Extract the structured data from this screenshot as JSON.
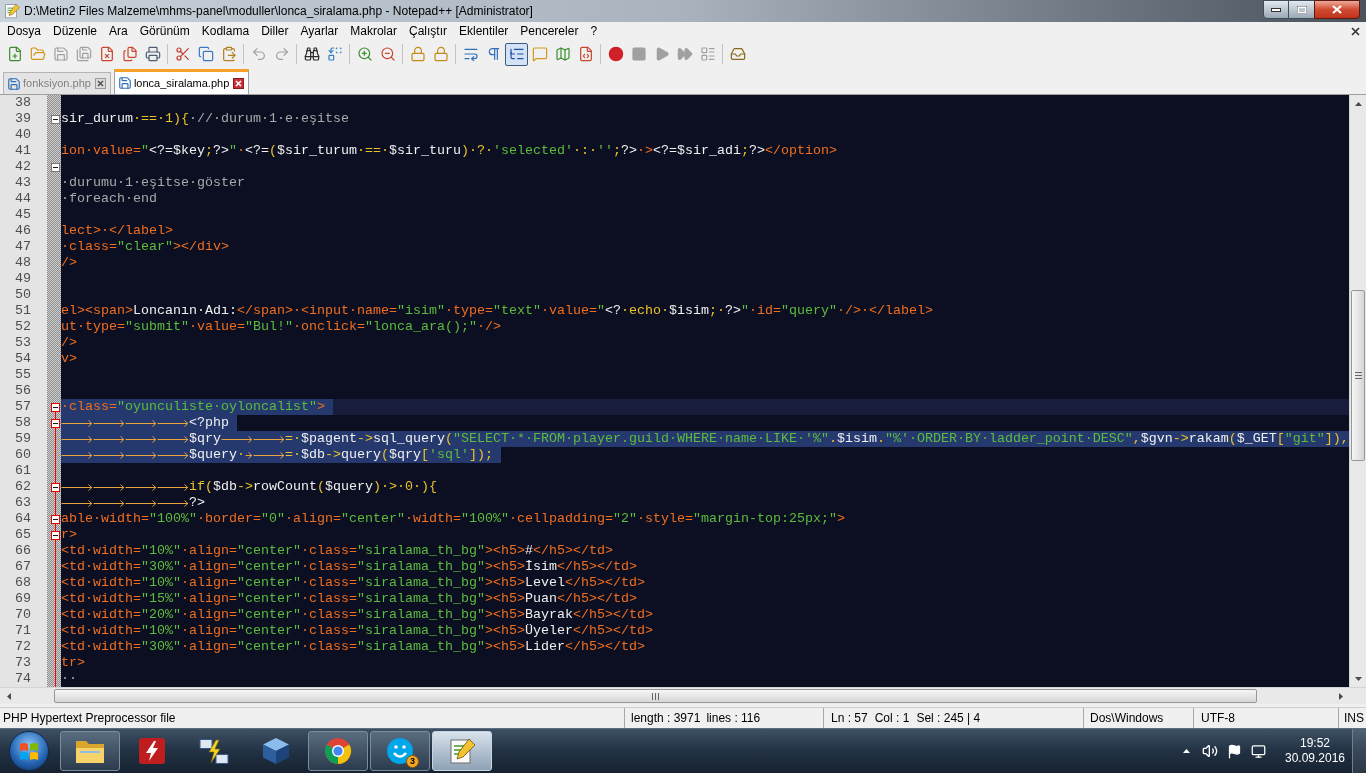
{
  "window": {
    "title": "D:\\Metin2 Files Malzeme\\mhms-panel\\moduller\\lonca_siralama.php - Notepad++ [Administrator]"
  },
  "menu": [
    "Dosya",
    "Düzenle",
    "Ara",
    "Görünüm",
    "Kodlama",
    "Diller",
    "Ayarlar",
    "Makrolar",
    "Çalıştır",
    "Eklentiler",
    "Pencereler",
    "?"
  ],
  "toolbar": [
    [
      {
        "kind": "new",
        "pressed": false,
        "disabled": false
      },
      {
        "kind": "open",
        "pressed": false,
        "disabled": false
      },
      {
        "kind": "save",
        "pressed": false,
        "disabled": true
      },
      {
        "kind": "saveall",
        "pressed": false,
        "disabled": true
      },
      {
        "kind": "close",
        "pressed": false,
        "disabled": false
      },
      {
        "kind": "closeall",
        "pressed": false,
        "disabled": false
      },
      {
        "kind": "print",
        "pressed": false,
        "disabled": false
      }
    ],
    [
      {
        "kind": "cut",
        "pressed": false,
        "disabled": false
      },
      {
        "kind": "copy",
        "pressed": false,
        "disabled": false
      },
      {
        "kind": "paste",
        "pressed": false,
        "disabled": false
      }
    ],
    [
      {
        "kind": "undo",
        "pressed": false,
        "disabled": true
      },
      {
        "kind": "redo",
        "pressed": false,
        "disabled": true
      }
    ],
    [
      {
        "kind": "find",
        "pressed": false,
        "disabled": false
      },
      {
        "kind": "replace",
        "pressed": false,
        "disabled": false
      }
    ],
    [
      {
        "kind": "zoomin",
        "pressed": false,
        "disabled": false
      },
      {
        "kind": "zoomout",
        "pressed": false,
        "disabled": false
      }
    ],
    [
      {
        "kind": "syncv",
        "pressed": false,
        "disabled": false
      },
      {
        "kind": "synch",
        "pressed": false,
        "disabled": false
      }
    ],
    [
      {
        "kind": "wrap",
        "pressed": false,
        "disabled": false
      },
      {
        "kind": "allchars",
        "pressed": false,
        "disabled": false
      },
      {
        "kind": "indent",
        "pressed": true,
        "disabled": false
      },
      {
        "kind": "udl",
        "pressed": false,
        "disabled": false
      },
      {
        "kind": "docmap",
        "pressed": false,
        "disabled": false
      },
      {
        "kind": "funclist",
        "pressed": false,
        "disabled": false
      }
    ],
    [
      {
        "kind": "record",
        "pressed": false,
        "disabled": false
      },
      {
        "kind": "stop",
        "pressed": false,
        "disabled": true
      },
      {
        "kind": "play",
        "pressed": false,
        "disabled": true
      },
      {
        "kind": "playmulti",
        "pressed": false,
        "disabled": true
      },
      {
        "kind": "savemacro",
        "pressed": false,
        "disabled": true
      }
    ],
    [
      {
        "kind": "plugin",
        "pressed": false,
        "disabled": false
      }
    ]
  ],
  "tabs": [
    {
      "label": "fonksiyon.php",
      "selected": false
    },
    {
      "label": "lonca_siralama.php",
      "selected": true
    }
  ],
  "editor": {
    "lines": [
      {
        "number": "38",
        "kind": "plain",
        "current": false,
        "selected": false
      },
      {
        "number": "39",
        "kind": "head",
        "fold_highlight": false,
        "current": false,
        "selected": false,
        "tokens": [
          {
            "kind": "php",
            "text": "sir_durum"
          },
          {
            "kind": "op",
            "text": "·==·1){"
          },
          {
            "kind": "cmt",
            "text": "·//·durum·1·e·eşitse"
          }
        ]
      },
      {
        "number": "40",
        "kind": "body",
        "current": false,
        "selected": false
      },
      {
        "number": "41",
        "kind": "body",
        "current": false,
        "selected": false,
        "tokens": [
          {
            "kind": "tag",
            "text": "ion·value="
          },
          {
            "kind": "str",
            "text": "\""
          },
          {
            "kind": "php",
            "text": "<?=$key"
          },
          {
            "kind": "op",
            "text": ";"
          },
          {
            "kind": "php",
            "text": "?>"
          },
          {
            "kind": "str",
            "text": "\""
          },
          {
            "kind": "tag",
            "text": "·"
          },
          {
            "kind": "php",
            "text": "<?="
          },
          {
            "kind": "op",
            "text": "("
          },
          {
            "kind": "php",
            "text": "$sir_turum"
          },
          {
            "kind": "op",
            "text": "·==·"
          },
          {
            "kind": "php",
            "text": "$sir_turu"
          },
          {
            "kind": "op",
            "text": ")·?·"
          },
          {
            "kind": "str",
            "text": "'selected'"
          },
          {
            "kind": "op",
            "text": "·:·"
          },
          {
            "kind": "str",
            "text": "''"
          },
          {
            "kind": "op",
            "text": ";"
          },
          {
            "kind": "php",
            "text": "?>"
          },
          {
            "kind": "tag",
            "text": "·>"
          },
          {
            "kind": "php",
            "text": "<?=$sir_adi"
          },
          {
            "kind": "op",
            "text": ";"
          },
          {
            "kind": "php",
            "text": "?>"
          },
          {
            "kind": "tag",
            "text": "</option>"
          }
        ]
      },
      {
        "number": "42",
        "kind": "head",
        "fold_highlight": false,
        "current": false,
        "selected": false
      },
      {
        "number": "43",
        "kind": "body",
        "current": false,
        "selected": false,
        "tokens": [
          {
            "kind": "cmt",
            "text": "·durumu·1·eşitse·göster"
          }
        ]
      },
      {
        "number": "44",
        "kind": "body",
        "current": false,
        "selected": false,
        "tokens": [
          {
            "kind": "cmt",
            "text": "·foreach·end"
          }
        ]
      },
      {
        "number": "45",
        "kind": "body",
        "current": false,
        "selected": false
      },
      {
        "number": "46",
        "kind": "body",
        "current": false,
        "selected": false,
        "tokens": [
          {
            "kind": "tag",
            "text": "lect>·</label>"
          }
        ]
      },
      {
        "number": "47",
        "kind": "body",
        "current": false,
        "selected": false,
        "tokens": [
          {
            "kind": "tag",
            "text": "·class="
          },
          {
            "kind": "str",
            "text": "\"clear\""
          },
          {
            "kind": "tag",
            "text": "></div>"
          }
        ]
      },
      {
        "number": "48",
        "kind": "body",
        "current": false,
        "selected": false,
        "tokens": [
          {
            "kind": "tag",
            "text": "/>"
          }
        ]
      },
      {
        "number": "49",
        "kind": "body",
        "current": false,
        "selected": false
      },
      {
        "number": "50",
        "kind": "body",
        "current": false,
        "selected": false
      },
      {
        "number": "51",
        "kind": "body",
        "current": false,
        "selected": false,
        "tokens": [
          {
            "kind": "tag",
            "text": "el><span>"
          },
          {
            "kind": "php",
            "text": "Loncanın·Adı:"
          },
          {
            "kind": "tag",
            "text": "</span>·<input·name="
          },
          {
            "kind": "str",
            "text": "\"isim\""
          },
          {
            "kind": "tag",
            "text": "·type="
          },
          {
            "kind": "str",
            "text": "\"text\""
          },
          {
            "kind": "tag",
            "text": "·value="
          },
          {
            "kind": "str",
            "text": "\""
          },
          {
            "kind": "php",
            "text": "<?"
          },
          {
            "kind": "op",
            "text": "·echo·"
          },
          {
            "kind": "php",
            "text": "$isim"
          },
          {
            "kind": "op",
            "text": ";·"
          },
          {
            "kind": "php",
            "text": "?>"
          },
          {
            "kind": "str",
            "text": "\""
          },
          {
            "kind": "tag",
            "text": "·id="
          },
          {
            "kind": "str",
            "text": "\"query\""
          },
          {
            "kind": "tag",
            "text": "·/>·</label>"
          }
        ]
      },
      {
        "number": "52",
        "kind": "body",
        "current": false,
        "selected": false,
        "tokens": [
          {
            "kind": "tag",
            "text": "ut·type="
          },
          {
            "kind": "str",
            "text": "\"submit\""
          },
          {
            "kind": "tag",
            "text": "·value="
          },
          {
            "kind": "str",
            "text": "\"Bul!\""
          },
          {
            "kind": "tag",
            "text": "·onclick="
          },
          {
            "kind": "str",
            "text": "\"lonca_ara();\""
          },
          {
            "kind": "tag",
            "text": "·/>"
          }
        ]
      },
      {
        "number": "53",
        "kind": "body",
        "current": false,
        "selected": false,
        "tokens": [
          {
            "kind": "tag",
            "text": "/>"
          }
        ]
      },
      {
        "number": "54",
        "kind": "body",
        "current": false,
        "selected": false,
        "tokens": [
          {
            "kind": "tag",
            "text": "v>"
          }
        ]
      },
      {
        "number": "55",
        "kind": "body",
        "current": false,
        "selected": false
      },
      {
        "number": "56",
        "kind": "body",
        "current": false,
        "selected": false
      },
      {
        "number": "57",
        "kind": "head",
        "fold_highlight": true,
        "current": true,
        "selected": true,
        "tokens": [
          {
            "kind": "tag",
            "text": "·class="
          },
          {
            "kind": "str",
            "text": "\"oyunculiste·oyloncalist\""
          },
          {
            "kind": "tag",
            "text": ">"
          }
        ]
      },
      {
        "number": "58",
        "kind": "head",
        "fold_highlight": true,
        "current": false,
        "selected": true,
        "tokens": [
          {
            "kind": "tab"
          },
          {
            "kind": "tab"
          },
          {
            "kind": "tab"
          },
          {
            "kind": "tab"
          },
          {
            "kind": "php",
            "text": "<?php"
          }
        ]
      },
      {
        "number": "59",
        "kind": "body",
        "current": false,
        "selected": true,
        "tokens": [
          {
            "kind": "tab"
          },
          {
            "kind": "tab"
          },
          {
            "kind": "tab"
          },
          {
            "kind": "tab"
          },
          {
            "kind": "php",
            "text": "$qry"
          },
          {
            "kind": "tab"
          },
          {
            "kind": "tab"
          },
          {
            "kind": "op",
            "text": "=·"
          },
          {
            "kind": "php",
            "text": "$pagent"
          },
          {
            "kind": "op",
            "text": "->"
          },
          {
            "kind": "php",
            "text": "sql_query"
          },
          {
            "kind": "op",
            "text": "("
          },
          {
            "kind": "str",
            "text": "\"SELECT·*·FROM·player.guild·WHERE·name·LIKE·'%\""
          },
          {
            "kind": "op",
            "text": "."
          },
          {
            "kind": "php",
            "text": "$isim"
          },
          {
            "kind": "op",
            "text": "."
          },
          {
            "kind": "str",
            "text": "\"%'·ORDER·BY·ladder_point·DESC\""
          },
          {
            "kind": "op",
            "text": ","
          },
          {
            "kind": "php",
            "text": "$gvn"
          },
          {
            "kind": "op",
            "text": "->"
          },
          {
            "kind": "php",
            "text": "rakam"
          },
          {
            "kind": "op",
            "text": "("
          },
          {
            "kind": "php",
            "text": "$_GET"
          },
          {
            "kind": "op",
            "text": "["
          },
          {
            "kind": "str",
            "text": "\"git\""
          },
          {
            "kind": "op",
            "text": "]),"
          }
        ]
      },
      {
        "number": "60",
        "kind": "body",
        "current": false,
        "selected": true,
        "tokens": [
          {
            "kind": "tab"
          },
          {
            "kind": "tab"
          },
          {
            "kind": "tab"
          },
          {
            "kind": "tab"
          },
          {
            "kind": "php",
            "text": "$query"
          },
          {
            "kind": "op",
            "text": "·"
          },
          {
            "kind": "tab"
          },
          {
            "kind": "tab"
          },
          {
            "kind": "op",
            "text": "=·"
          },
          {
            "kind": "php",
            "text": "$db"
          },
          {
            "kind": "op",
            "text": "->"
          },
          {
            "kind": "php",
            "text": "query"
          },
          {
            "kind": "op",
            "text": "("
          },
          {
            "kind": "php",
            "text": "$qry"
          },
          {
            "kind": "op",
            "text": "["
          },
          {
            "kind": "str",
            "text": "'sql'"
          },
          {
            "kind": "op",
            "text": "]);"
          }
        ]
      },
      {
        "number": "61",
        "kind": "body",
        "current": false,
        "selected": false
      },
      {
        "number": "62",
        "kind": "head",
        "fold_highlight": true,
        "current": false,
        "selected": false,
        "tokens": [
          {
            "kind": "tab"
          },
          {
            "kind": "tab"
          },
          {
            "kind": "tab"
          },
          {
            "kind": "tab"
          },
          {
            "kind": "op",
            "text": "if("
          },
          {
            "kind": "php",
            "text": "$db"
          },
          {
            "kind": "op",
            "text": "->"
          },
          {
            "kind": "php",
            "text": "rowCount"
          },
          {
            "kind": "op",
            "text": "("
          },
          {
            "kind": "php",
            "text": "$query"
          },
          {
            "kind": "op",
            "text": ")·>·0·){"
          }
        ]
      },
      {
        "number": "63",
        "kind": "body",
        "current": false,
        "selected": false,
        "tokens": [
          {
            "kind": "tab"
          },
          {
            "kind": "tab"
          },
          {
            "kind": "tab"
          },
          {
            "kind": "tab"
          },
          {
            "kind": "php",
            "text": "?>"
          }
        ]
      },
      {
        "number": "64",
        "kind": "head",
        "fold_highlight": true,
        "current": false,
        "selected": false,
        "tokens": [
          {
            "kind": "tag",
            "text": "able·width="
          },
          {
            "kind": "str",
            "text": "\"100%\""
          },
          {
            "kind": "tag",
            "text": "·border="
          },
          {
            "kind": "str",
            "text": "\"0\""
          },
          {
            "kind": "tag",
            "text": "·align="
          },
          {
            "kind": "str",
            "text": "\"center\""
          },
          {
            "kind": "tag",
            "text": "·width="
          },
          {
            "kind": "str",
            "text": "\"100%\""
          },
          {
            "kind": "tag",
            "text": "·cellpadding="
          },
          {
            "kind": "str",
            "text": "\"2\""
          },
          {
            "kind": "tag",
            "text": "·style="
          },
          {
            "kind": "str",
            "text": "\"margin-top:25px;\""
          },
          {
            "kind": "tag",
            "text": ">"
          }
        ]
      },
      {
        "number": "65",
        "kind": "head",
        "fold_highlight": true,
        "current": false,
        "selected": false,
        "tokens": [
          {
            "kind": "tag",
            "text": "r>"
          }
        ]
      },
      {
        "number": "66",
        "kind": "body",
        "current": false,
        "selected": false,
        "tokens": [
          {
            "kind": "tag",
            "text": "<td·width="
          },
          {
            "kind": "str",
            "text": "\"10%\""
          },
          {
            "kind": "tag",
            "text": "·align="
          },
          {
            "kind": "str",
            "text": "\"center\""
          },
          {
            "kind": "tag",
            "text": "·class="
          },
          {
            "kind": "str",
            "text": "\"siralama_th_bg\""
          },
          {
            "kind": "tag",
            "text": "><h5>"
          },
          {
            "kind": "php",
            "text": "#"
          },
          {
            "kind": "tag",
            "text": "</h5></td>"
          }
        ]
      },
      {
        "number": "67",
        "kind": "body",
        "current": false,
        "selected": false,
        "tokens": [
          {
            "kind": "tag",
            "text": "<td·width="
          },
          {
            "kind": "str",
            "text": "\"30%\""
          },
          {
            "kind": "tag",
            "text": "·align="
          },
          {
            "kind": "str",
            "text": "\"center\""
          },
          {
            "kind": "tag",
            "text": "·class="
          },
          {
            "kind": "str",
            "text": "\"siralama_th_bg\""
          },
          {
            "kind": "tag",
            "text": "><h5>"
          },
          {
            "kind": "php",
            "text": "İsim"
          },
          {
            "kind": "tag",
            "text": "</h5></td>"
          }
        ]
      },
      {
        "number": "68",
        "kind": "body",
        "current": false,
        "selected": false,
        "tokens": [
          {
            "kind": "tag",
            "text": "<td·width="
          },
          {
            "kind": "str",
            "text": "\"10%\""
          },
          {
            "kind": "tag",
            "text": "·align="
          },
          {
            "kind": "str",
            "text": "\"center\""
          },
          {
            "kind": "tag",
            "text": "·class="
          },
          {
            "kind": "str",
            "text": "\"siralama_th_bg\""
          },
          {
            "kind": "tag",
            "text": "><h5>"
          },
          {
            "kind": "php",
            "text": "Level"
          },
          {
            "kind": "tag",
            "text": "</h5></td>"
          }
        ]
      },
      {
        "number": "69",
        "kind": "body",
        "current": false,
        "selected": false,
        "tokens": [
          {
            "kind": "tag",
            "text": "<td·width="
          },
          {
            "kind": "str",
            "text": "\"15%\""
          },
          {
            "kind": "tag",
            "text": "·align="
          },
          {
            "kind": "str",
            "text": "\"center\""
          },
          {
            "kind": "tag",
            "text": "·class="
          },
          {
            "kind": "str",
            "text": "\"siralama_th_bg\""
          },
          {
            "kind": "tag",
            "text": "><h5>"
          },
          {
            "kind": "php",
            "text": "Puan"
          },
          {
            "kind": "tag",
            "text": "</h5></td>"
          }
        ]
      },
      {
        "number": "70",
        "kind": "body",
        "current": false,
        "selected": false,
        "tokens": [
          {
            "kind": "tag",
            "text": "<td·width="
          },
          {
            "kind": "str",
            "text": "\"20%\""
          },
          {
            "kind": "tag",
            "text": "·align="
          },
          {
            "kind": "str",
            "text": "\"center\""
          },
          {
            "kind": "tag",
            "text": "·class="
          },
          {
            "kind": "str",
            "text": "\"siralama_th_bg\""
          },
          {
            "kind": "tag",
            "text": "><h5>"
          },
          {
            "kind": "php",
            "text": "Bayrak"
          },
          {
            "kind": "tag",
            "text": "</h5></td>"
          }
        ]
      },
      {
        "number": "71",
        "kind": "body",
        "current": false,
        "selected": false,
        "tokens": [
          {
            "kind": "tag",
            "text": "<td·width="
          },
          {
            "kind": "str",
            "text": "\"10%\""
          },
          {
            "kind": "tag",
            "text": "·align="
          },
          {
            "kind": "str",
            "text": "\"center\""
          },
          {
            "kind": "tag",
            "text": "·class="
          },
          {
            "kind": "str",
            "text": "\"siralama_th_bg\""
          },
          {
            "kind": "tag",
            "text": "><h5>"
          },
          {
            "kind": "php",
            "text": "Üyeler"
          },
          {
            "kind": "tag",
            "text": "</h5></td>"
          }
        ]
      },
      {
        "number": "72",
        "kind": "body",
        "current": false,
        "selected": false,
        "tokens": [
          {
            "kind": "tag",
            "text": "<td·width="
          },
          {
            "kind": "str",
            "text": "\"30%\""
          },
          {
            "kind": "tag",
            "text": "·align="
          },
          {
            "kind": "str",
            "text": "\"center\""
          },
          {
            "kind": "tag",
            "text": "·class="
          },
          {
            "kind": "str",
            "text": "\"siralama_th_bg\""
          },
          {
            "kind": "tag",
            "text": "><h5>"
          },
          {
            "kind": "php",
            "text": "Lider"
          },
          {
            "kind": "tag",
            "text": "</h5></td>"
          }
        ]
      },
      {
        "number": "73",
        "kind": "body",
        "current": false,
        "selected": false,
        "tokens": [
          {
            "kind": "tag",
            "text": "tr>"
          }
        ]
      },
      {
        "number": "74",
        "kind": "body",
        "current": false,
        "selected": false,
        "tokens": [
          {
            "kind": "cmt",
            "text": "··"
          }
        ]
      }
    ]
  },
  "status_bar": {
    "file_type": "PHP Hypertext Preprocessor file",
    "length": "length : 3971",
    "lines": "lines : 116",
    "line": "Ln : 57",
    "column": "Col : 1",
    "selection": "Sel : 245 | 4",
    "line_ending": "Dos\\Windows",
    "encoding": "UTF-8",
    "mode": "INS"
  },
  "taskbar": {
    "buttons": [
      {
        "kind": "folder",
        "running": true,
        "active": false
      },
      {
        "kind": "ftp",
        "running": false,
        "active": false
      },
      {
        "kind": "transfer",
        "running": false,
        "active": false
      },
      {
        "kind": "cube",
        "running": false,
        "active": false
      },
      {
        "kind": "browser",
        "running": true,
        "active": false
      },
      {
        "kind": "chat",
        "running": true,
        "active": false,
        "badge": "3"
      },
      {
        "kind": "notepad",
        "running": true,
        "active": true
      }
    ],
    "clock": {
      "time": "19:52",
      "date": "30.09.2016"
    }
  }
}
